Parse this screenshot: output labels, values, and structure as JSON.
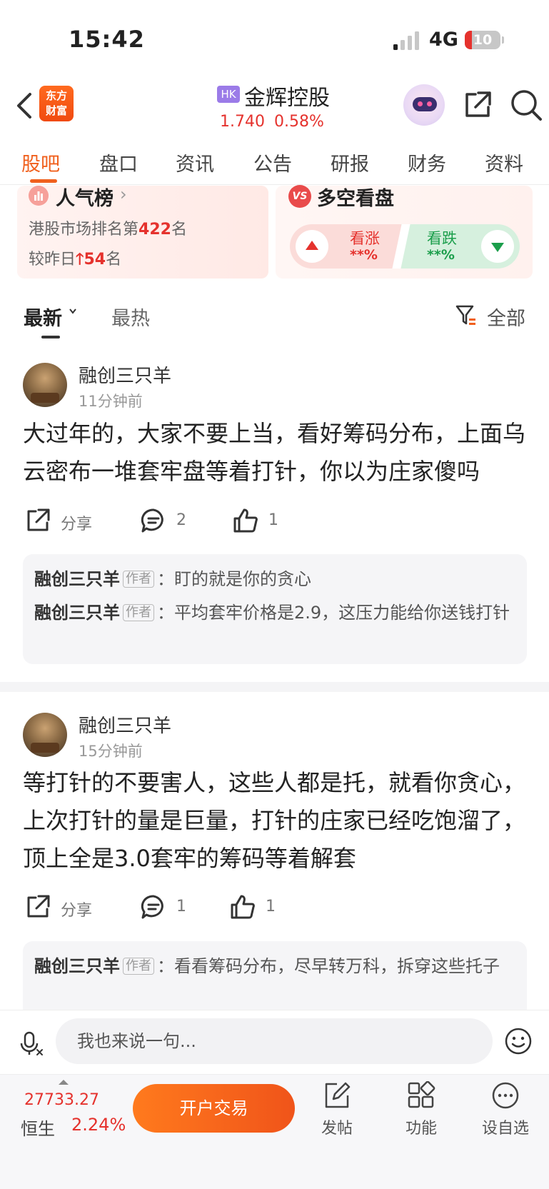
{
  "status_bar": {
    "time": "15:42",
    "network": "4G",
    "battery": "10"
  },
  "header": {
    "logo_line1": "东方",
    "logo_line2": "财富",
    "market_tag": "HK",
    "stock_name": "金辉控股",
    "price": "1.740",
    "change_pct": "0.58%"
  },
  "tabs": [
    "股吧",
    "盘口",
    "资讯",
    "公告",
    "研报",
    "财务",
    "资料"
  ],
  "rank": {
    "title": "人气榜",
    "chevron": "›",
    "line1_prefix": "港股市场排名第",
    "line1_value": "422",
    "line1_suffix": "名",
    "line2_prefix": "较昨日",
    "line2_arrow": "🡑",
    "line2_value": "54",
    "line2_suffix": "名"
  },
  "vote": {
    "badge": "VS",
    "title": "多空看盘",
    "up_label": "看涨",
    "up_value": "**%",
    "down_label": "看跌",
    "down_value": "**%"
  },
  "sort": {
    "latest": "最新",
    "hot": "最热",
    "filter": "全部"
  },
  "posts": [
    {
      "author": "融创三只羊",
      "time": "11分钟前",
      "text": "大过年的，大家不要上当，看好筹码分布，上面乌云密布一堆套牢盘等着打针，你以为庄家傻吗",
      "share": "分享",
      "comments": "2",
      "likes": "1",
      "replies": [
        {
          "author": "融创三只羊",
          "badge": "作者",
          "sep": "：",
          "text": "盯的就是你的贪心"
        },
        {
          "author": "融创三只羊",
          "badge": "作者",
          "sep": "：",
          "text": "平均套牢价格是2.9，这压力能给你送钱打针"
        }
      ]
    },
    {
      "author": "融创三只羊",
      "time": "15分钟前",
      "text": "等打针的不要害人，这些人都是托，就看你贪心，上次打针的量是巨量，打针的庄家已经吃饱溜了，顶上全是3.0套牢的筹码等着解套",
      "share": "分享",
      "comments": "1",
      "likes": "1",
      "replies": [
        {
          "author": "融创三只羊",
          "badge": "作者",
          "sep": "：",
          "text": "看看筹码分布，尽早转万科，拆穿这些托子"
        }
      ]
    }
  ],
  "input": {
    "placeholder": "我也来说一句..."
  },
  "bottom": {
    "index_value": "27733.27",
    "index_name": "恒生",
    "index_pct": "2.24%",
    "open_button": "开户交易",
    "nav": [
      "发帖",
      "功能",
      "设自选"
    ]
  },
  "colors": {
    "accent": "#f0601d",
    "up": "#e5322d",
    "down": "#1b9e4b"
  }
}
